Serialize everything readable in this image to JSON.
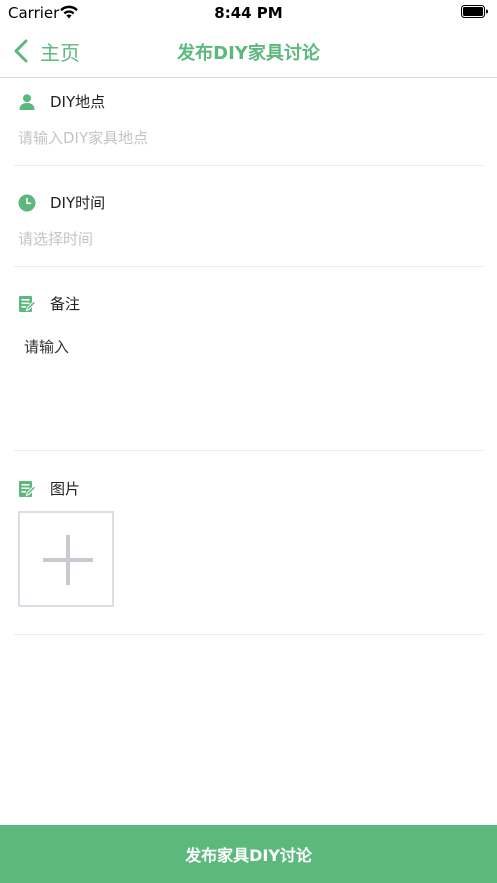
{
  "status_bar": {
    "carrier": "Carrier",
    "time": "8:44 PM"
  },
  "nav": {
    "back_label": "主页",
    "title": "发布DIY家具讨论"
  },
  "form": {
    "location": {
      "label": "DIY地点",
      "placeholder": "请输入DIY家具地点",
      "value": "",
      "icon": "person-icon"
    },
    "time": {
      "label": "DIY时间",
      "placeholder": "请选择时间",
      "value": "",
      "icon": "clock-icon"
    },
    "notes": {
      "label": "备注",
      "placeholder": "请输入",
      "value": "",
      "icon": "edit-note-icon"
    },
    "photos": {
      "label": "图片",
      "icon": "edit-note-icon"
    }
  },
  "submit": {
    "label": "发布家具DIY讨论"
  },
  "colors": {
    "accent": "#5cb87c",
    "divider": "#ececec",
    "placeholder": "#c4c4c4"
  }
}
